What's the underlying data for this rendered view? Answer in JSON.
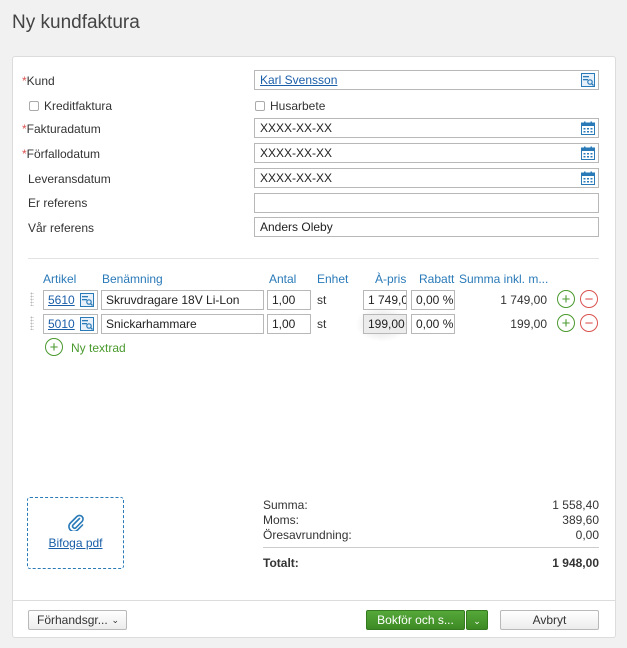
{
  "page": {
    "title": "Ny kundfaktura"
  },
  "form": {
    "kund_label": "Kund",
    "kund_value": "Karl Svensson",
    "kreditfaktura_label": "Kreditfaktura",
    "husarbete_label": "Husarbete",
    "fakturadatum_label": "Fakturadatum",
    "fakturadatum_value": "XXXX-XX-XX",
    "forfallodatum_label": "Förfallodatum",
    "forfallodatum_value": "XXXX-XX-XX",
    "leveransdatum_label": "Leveransdatum",
    "leveransdatum_value": "XXXX-XX-XX",
    "er_referens_label": "Er referens",
    "er_referens_value": "",
    "var_referens_label": "Vår referens",
    "var_referens_value": "Anders Oleby",
    "required_mark": "*"
  },
  "table": {
    "headers": {
      "artikel": "Artikel",
      "benamning": "Benämning",
      "antal": "Antal",
      "enhet": "Enhet",
      "apris": "À-pris",
      "rabatt": "Rabatt",
      "summa": "Summa inkl. m..."
    },
    "rows": [
      {
        "artikel": "5610",
        "benamning": "Skruvdragare 18V Li-Lon",
        "antal": "1,00",
        "enhet": "st",
        "apris": "1 749,0",
        "rabatt": "0,00 %",
        "summa": "1 749,00"
      },
      {
        "artikel": "5010",
        "benamning": "Snickarhammare",
        "antal": "1,00",
        "enhet": "st",
        "apris": "199,00",
        "rabatt": "0,00 %",
        "summa": "199,00"
      }
    ],
    "add_textrow": "Ny textrad",
    "add_symbol": "+",
    "remove_symbol": "−"
  },
  "attachment": {
    "label": "Bifoga pdf"
  },
  "totals": {
    "summa_label": "Summa:",
    "summa_value": "1 558,40",
    "moms_label": "Moms:",
    "moms_value": "389,60",
    "oresavrundning_label": "Öresavrundning:",
    "oresavrundning_value": "0,00",
    "totalt_label": "Totalt:",
    "totalt_value": "1 948,00"
  },
  "footer": {
    "preview_label": "Förhandsgr...",
    "book_label": "Bokför och s...",
    "cancel_label": "Avbryt"
  },
  "colors": {
    "accent": "#2a7ab8",
    "green": "#4a9a2e",
    "red": "#d9534f"
  }
}
